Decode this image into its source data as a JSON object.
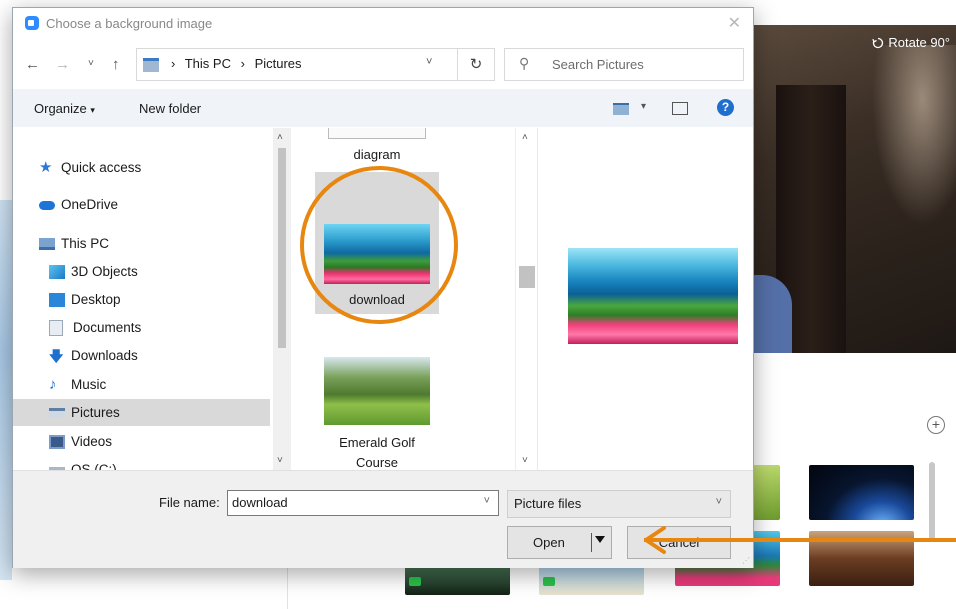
{
  "dialog": {
    "title": "Choose a background image",
    "address_crumbs": [
      "This PC",
      "Pictures"
    ],
    "search_placeholder": "Search Pictures",
    "toolbar": {
      "organize": "Organize",
      "new_folder": "New folder"
    }
  },
  "nav_pane": {
    "items": [
      {
        "label": "Quick access",
        "icon": "star-icon"
      },
      {
        "label": "OneDrive",
        "icon": "cloud-icon"
      },
      {
        "label": "This PC",
        "icon": "computer-icon"
      },
      {
        "label": "3D Objects",
        "icon": "cube-icon"
      },
      {
        "label": "Desktop",
        "icon": "desktop-folder-icon"
      },
      {
        "label": "Documents",
        "icon": "document-icon"
      },
      {
        "label": "Downloads",
        "icon": "download-arrow-icon"
      },
      {
        "label": "Music",
        "icon": "music-note-icon"
      },
      {
        "label": "Pictures",
        "icon": "pictures-folder-icon"
      },
      {
        "label": "Videos",
        "icon": "video-icon"
      },
      {
        "label": "OS (C:)",
        "icon": "drive-icon"
      }
    ],
    "selected": "Pictures"
  },
  "files": [
    {
      "name": "diagram"
    },
    {
      "name": "download"
    },
    {
      "name": "Emerald Golf Course"
    }
  ],
  "footer": {
    "file_name_label": "File name:",
    "file_name_value": "download",
    "file_type": "Picture files",
    "open_label": "Open",
    "cancel_label": "Cancel"
  },
  "background_app": {
    "rotate_label": "Rotate 90°"
  },
  "colors": {
    "accent_orange": "#e8870f",
    "selection_gray": "#d9d9d9",
    "help_blue": "#1f6fcf"
  }
}
